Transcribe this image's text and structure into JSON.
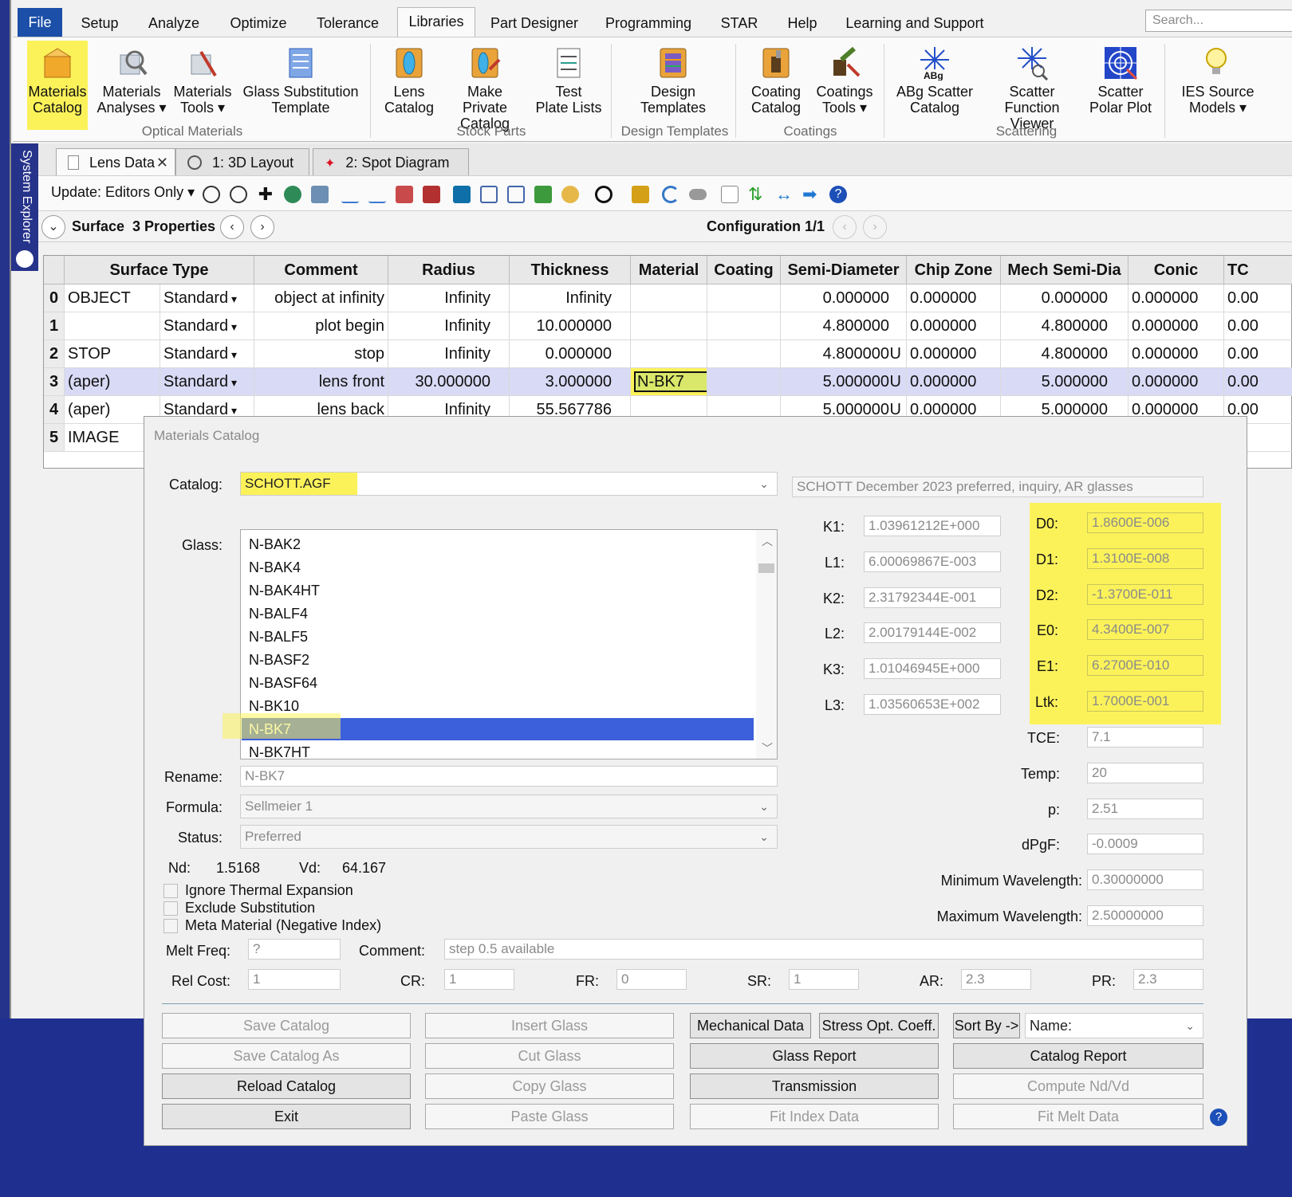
{
  "menu": {
    "tabs": [
      "File",
      "Setup",
      "Analyze",
      "Optimize",
      "Tolerance",
      "Libraries",
      "Part Designer",
      "Programming",
      "STAR",
      "Help",
      "Learning and Support"
    ],
    "search_placeholder": "Search..."
  },
  "ribbon": {
    "buttons": [
      {
        "line1": "Materials",
        "line2": "Catalog"
      },
      {
        "line1": "Materials",
        "line2": "Analyses ▾"
      },
      {
        "line1": "Materials",
        "line2": "Tools ▾"
      },
      {
        "line1": "Glass Substitution",
        "line2": "Template"
      },
      {
        "line1": "Lens",
        "line2": "Catalog"
      },
      {
        "line1": "Make Private",
        "line2": "Catalog"
      },
      {
        "line1": "Test",
        "line2": "Plate Lists"
      },
      {
        "line1": "Design",
        "line2": "Templates"
      },
      {
        "line1": "Coating",
        "line2": "Catalog"
      },
      {
        "line1": "Coatings",
        "line2": "Tools ▾"
      },
      {
        "line1": "ABg Scatter",
        "line2": "Catalog"
      },
      {
        "line1": "Scatter",
        "line2": "Function Viewer"
      },
      {
        "line1": "Scatter",
        "line2": "Polar Plot"
      },
      {
        "line1": "IES Source",
        "line2": "Models ▾"
      }
    ],
    "groups": [
      "Optical Materials",
      "Stock Parts",
      "Design Templates",
      "Coatings",
      "Scattering"
    ]
  },
  "system_explorer": "System Explorer",
  "doc_tabs": [
    "Lens Data",
    "1: 3D Layout",
    "2: Spot Diagram"
  ],
  "editor": {
    "update_label": "Update: Editors Only ▾",
    "surface_label": "Surface",
    "properties_label": "3 Properties",
    "configuration_label": "Configuration 1/1"
  },
  "lens_table": {
    "headers": [
      "Surface Type",
      "Comment",
      "Radius",
      "Thickness",
      "Material",
      "Coating",
      "Semi-Diameter",
      "Chip Zone",
      "Mech Semi-Dia",
      "Conic",
      "TC"
    ],
    "rows": [
      {
        "num": "0",
        "name": "OBJECT",
        "type": "Standard",
        "comment": "object at infinity",
        "radius": "Infinity",
        "thickness": "Infinity",
        "material": "",
        "semi": "0.000000",
        "semi_flag": "",
        "chip": "0.000000",
        "mech": "0.000000",
        "conic": "0.000000",
        "tc": "0.00"
      },
      {
        "num": "1",
        "name": "",
        "type": "Standard",
        "comment": "plot begin",
        "radius": "Infinity",
        "thickness": "10.000000",
        "material": "",
        "semi": "4.800000",
        "semi_flag": "",
        "chip": "0.000000",
        "mech": "4.800000",
        "conic": "0.000000",
        "tc": "0.00"
      },
      {
        "num": "2",
        "name": "STOP",
        "type": "Standard",
        "comment": "stop",
        "radius": "Infinity",
        "thickness": "0.000000",
        "material": "",
        "semi": "4.800000",
        "semi_flag": "U",
        "chip": "0.000000",
        "mech": "4.800000",
        "conic": "0.000000",
        "tc": "0.00"
      },
      {
        "num": "3",
        "name": "(aper)",
        "type": "Standard",
        "comment": "lens front",
        "radius": "30.000000",
        "thickness": "3.000000",
        "material": "N-BK7",
        "semi": "5.000000",
        "semi_flag": "U",
        "chip": "0.000000",
        "mech": "5.000000",
        "conic": "0.000000",
        "tc": "0.00"
      },
      {
        "num": "4",
        "name": "(aper)",
        "type": "Standard",
        "comment": "lens back",
        "radius": "Infinity",
        "thickness": "55.567786",
        "material": "",
        "semi": "5.000000",
        "semi_flag": "U",
        "chip": "0.000000",
        "mech": "5.000000",
        "conic": "0.000000",
        "tc": "0.00"
      },
      {
        "num": "5",
        "name": "IMAGE",
        "type": "",
        "comment": "",
        "radius": "",
        "thickness": "",
        "material": "",
        "semi": "",
        "semi_flag": "",
        "chip": "",
        "mech": "",
        "conic": "",
        "tc": ""
      }
    ]
  },
  "dialog": {
    "title": "Materials Catalog",
    "catalog_label": "Catalog:",
    "catalog_value": "SCHOTT.AGF",
    "catalog_desc": "SCHOTT December 2023 preferred, inquiry, AR glasses",
    "glass_label": "Glass:",
    "glasses": [
      "N-BAK2",
      "N-BAK4",
      "N-BAK4HT",
      "N-BALF4",
      "N-BALF5",
      "N-BASF2",
      "N-BASF64",
      "N-BK10",
      "N-BK7",
      "N-BK7HT"
    ],
    "selected_glass": "N-BK7",
    "rename_label": "Rename:",
    "rename_value": "N-BK7",
    "formula_label": "Formula:",
    "formula_value": "Sellmeier 1",
    "status_label": "Status:",
    "status_value": "Preferred",
    "nd_label": "Nd:",
    "nd_value": "1.5168",
    "vd_label": "Vd:",
    "vd_value": "64.167",
    "checkboxes": [
      "Ignore Thermal Expansion",
      "Exclude Substitution",
      "Meta Material (Negative Index)"
    ],
    "coeffs_k": [
      {
        "label": "K1:",
        "value": "1.03961212E+000"
      },
      {
        "label": "L1:",
        "value": "6.00069867E-003"
      },
      {
        "label": "K2:",
        "value": "2.31792344E-001"
      },
      {
        "label": "L2:",
        "value": "2.00179144E-002"
      },
      {
        "label": "K3:",
        "value": "1.01046945E+000"
      },
      {
        "label": "L3:",
        "value": "1.03560653E+002"
      }
    ],
    "coeffs_d": [
      {
        "label": "D0:",
        "value": "1.8600E-006"
      },
      {
        "label": "D1:",
        "value": "1.3100E-008"
      },
      {
        "label": "D2:",
        "value": "-1.3700E-011"
      },
      {
        "label": "E0:",
        "value": "4.3400E-007"
      },
      {
        "label": "E1:",
        "value": "6.2700E-010"
      },
      {
        "label": "Ltk:",
        "value": "1.7000E-001"
      }
    ],
    "props": [
      {
        "label": "TCE:",
        "value": "7.1"
      },
      {
        "label": "Temp:",
        "value": "20"
      },
      {
        "label": "p:",
        "value": "2.51"
      },
      {
        "label": "dPgF:",
        "value": "-0.0009"
      }
    ],
    "min_wl_label": "Minimum Wavelength:",
    "min_wl_value": "0.30000000",
    "max_wl_label": "Maximum Wavelength:",
    "max_wl_value": "2.50000000",
    "melt_label": "Melt Freq:",
    "melt_value": "?",
    "comment_label": "Comment:",
    "comment_value": "step 0.5 available",
    "relcost_label": "Rel Cost:",
    "relcost_value": "1",
    "cr_label": "CR:",
    "cr_value": "1",
    "fr_label": "FR:",
    "fr_value": "0",
    "sr_label": "SR:",
    "sr_value": "1",
    "ar_label": "AR:",
    "ar_value": "2.3",
    "pr_label": "PR:",
    "pr_value": "2.3",
    "buttons": {
      "save_catalog": "Save Catalog",
      "save_catalog_as": "Save Catalog As",
      "reload_catalog": "Reload Catalog",
      "exit": "Exit",
      "insert_glass": "Insert Glass",
      "cut_glass": "Cut Glass",
      "copy_glass": "Copy Glass",
      "paste_glass": "Paste Glass",
      "mechanical_data": "Mechanical Data",
      "stress_opt": "Stress Opt. Coeff.",
      "glass_report": "Glass Report",
      "transmission": "Transmission",
      "fit_index": "Fit Index Data",
      "sort_by": "Sort By ->",
      "sort_value": "Name:",
      "catalog_report": "Catalog Report",
      "compute_nd": "Compute Nd/Vd",
      "fit_melt": "Fit Melt Data"
    }
  },
  "colors": {
    "highlight": "#fbf25a",
    "selection": "#3c5fdb",
    "file_tab": "#1b4fa8",
    "window_bg": "#1e2f8f"
  }
}
